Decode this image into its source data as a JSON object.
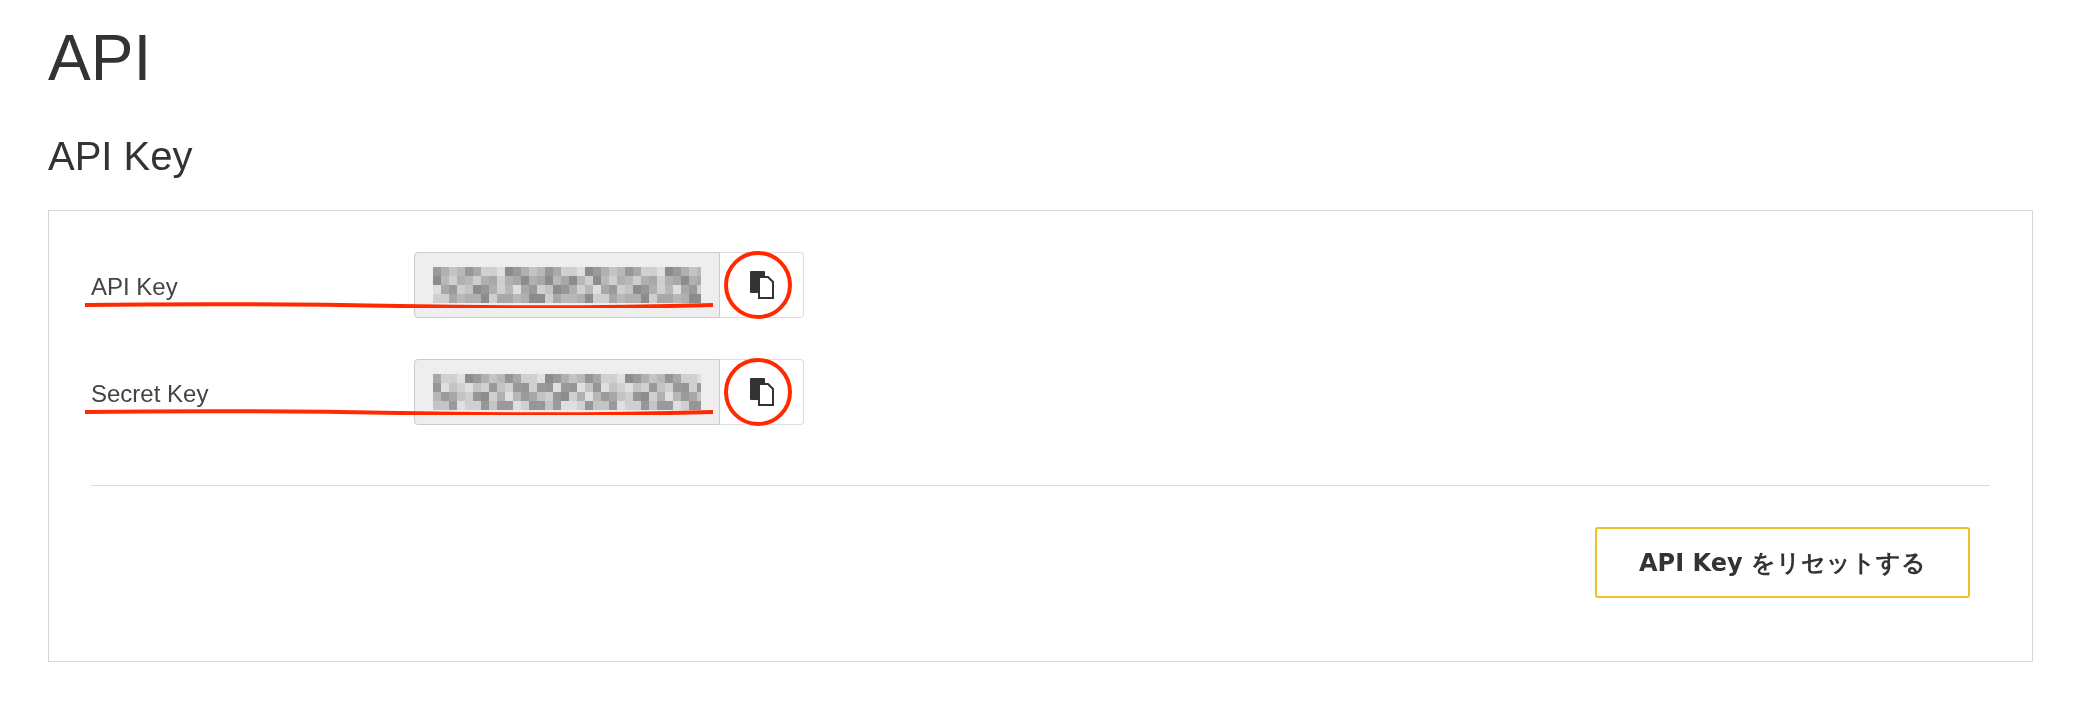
{
  "page_title": "API",
  "section_title": "API Key",
  "fields": [
    {
      "label": "API Key",
      "annotated": true
    },
    {
      "label": "Secret Key",
      "annotated": true
    }
  ],
  "reset_button": "API Key をリセットする"
}
